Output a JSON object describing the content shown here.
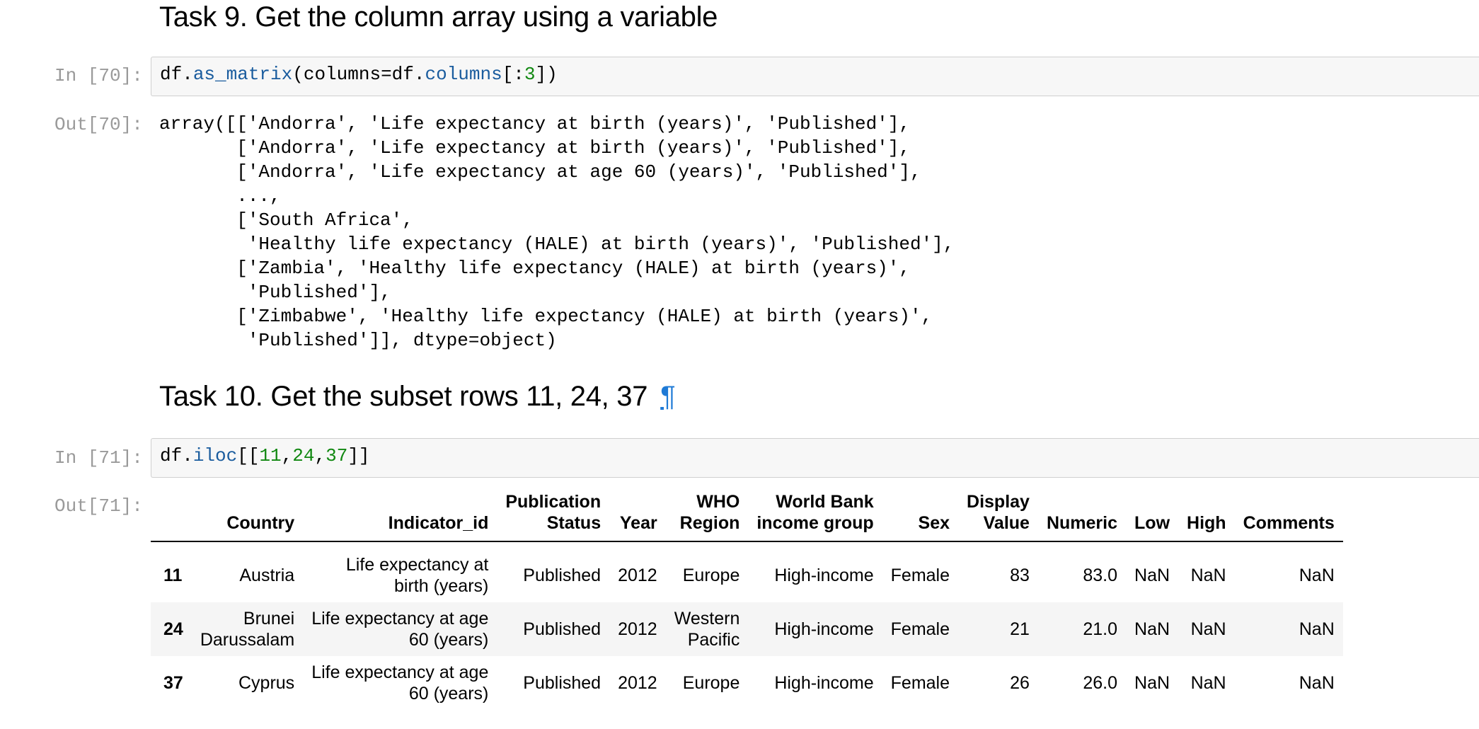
{
  "task9": {
    "heading": "Task 9. Get the column array using a variable",
    "in_prompt": "In [70]:",
    "code": {
      "obj": "df.",
      "method": "as_matrix",
      "args_pre": "(columns=df.",
      "attr": "columns",
      "slice_open": "[:",
      "num": "3",
      "close": "])"
    },
    "out_prompt": "Out[70]:",
    "output": "array([['Andorra', 'Life expectancy at birth (years)', 'Published'],\n       ['Andorra', 'Life expectancy at birth (years)', 'Published'],\n       ['Andorra', 'Life expectancy at age 60 (years)', 'Published'],\n       ...,\n       ['South Africa',\n        'Healthy life expectancy (HALE) at birth (years)', 'Published'],\n       ['Zambia', 'Healthy life expectancy (HALE) at birth (years)',\n        'Published'],\n       ['Zimbabwe', 'Healthy life expectancy (HALE) at birth (years)',\n        'Published']], dtype=object)"
  },
  "task10": {
    "heading": "Task 10. Get the subset rows 11, 24, 37",
    "anchor": "¶",
    "in_prompt": "In [71]:",
    "code": {
      "obj": "df.",
      "method": "iloc",
      "open": "[[",
      "n1": "11",
      "c1": ",",
      "n2": "24",
      "c2": ",",
      "n3": "37",
      "close": "]]"
    },
    "out_prompt": "Out[71]:",
    "table": {
      "columns": [
        "",
        "Country",
        "Indicator_id",
        "Publication\nStatus",
        "Year",
        "WHO\nRegion",
        "World Bank\nincome group",
        "Sex",
        "Display\nValue",
        "Numeric",
        "Low",
        "High",
        "Comments"
      ],
      "rows": [
        [
          "11",
          "Austria",
          "Life expectancy at\nbirth (years)",
          "Published",
          "2012",
          "Europe",
          "High-income",
          "Female",
          "83",
          "83.0",
          "NaN",
          "NaN",
          "NaN"
        ],
        [
          "24",
          "Brunei\nDarussalam",
          "Life expectancy at age\n60 (years)",
          "Published",
          "2012",
          "Western\nPacific",
          "High-income",
          "Female",
          "21",
          "21.0",
          "NaN",
          "NaN",
          "NaN"
        ],
        [
          "37",
          "Cyprus",
          "Life expectancy at age\n60 (years)",
          "Published",
          "2012",
          "Europe",
          "High-income",
          "Female",
          "26",
          "26.0",
          "NaN",
          "NaN",
          "NaN"
        ]
      ]
    }
  }
}
